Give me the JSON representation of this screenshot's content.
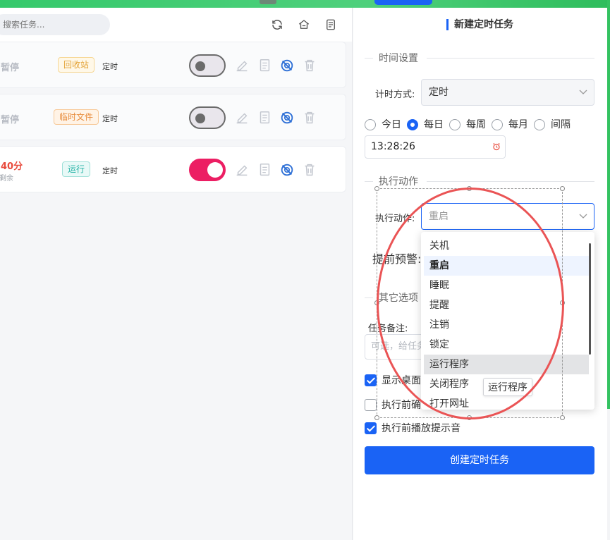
{
  "left": {
    "search_placeholder": "搜索任务...",
    "tasks": [
      {
        "status": "暂停",
        "sub": "",
        "tag": "回收站",
        "type": "定时",
        "enabled": false
      },
      {
        "status": "暂停",
        "sub": "",
        "tag": "临时文件",
        "type": "定时",
        "enabled": false
      },
      {
        "status": "40分",
        "sub": "剩余",
        "tag": "运行",
        "type": "定时",
        "enabled": true
      }
    ]
  },
  "right": {
    "title": "新建定时任务",
    "section_time": "时间设置",
    "timing_label": "计时方式:",
    "timing_value": "定时",
    "radios": [
      "今日",
      "每日",
      "每周",
      "每月",
      "间隔"
    ],
    "radio_selected": "每日",
    "time_value": "13:28:26",
    "section_action": "执行动作",
    "action_label": "执行动作:",
    "action_value": "重启",
    "warn_label": "提前预警:",
    "section_other": "其它选项",
    "note_label": "任务备注:",
    "note_placeholder": "可选，给任务",
    "checks": [
      {
        "label": "显示桌面",
        "checked": true
      },
      {
        "label": "执行前确",
        "checked": false
      },
      {
        "label": "执行前播放提示音",
        "checked": true
      }
    ],
    "create_button": "创建定时任务"
  },
  "dropdown": {
    "items": [
      "关机",
      "重启",
      "睡眠",
      "提醒",
      "注销",
      "锁定",
      "运行程序",
      "关闭程序",
      "打开网址"
    ],
    "selected": "重启",
    "hovered": "运行程序",
    "tooltip": "运行程序"
  },
  "colors": {
    "accent": "#1a63f5",
    "toggle_on": "#ec1e63",
    "annotation": "#ea5455",
    "top_bar": "#35c96b"
  }
}
